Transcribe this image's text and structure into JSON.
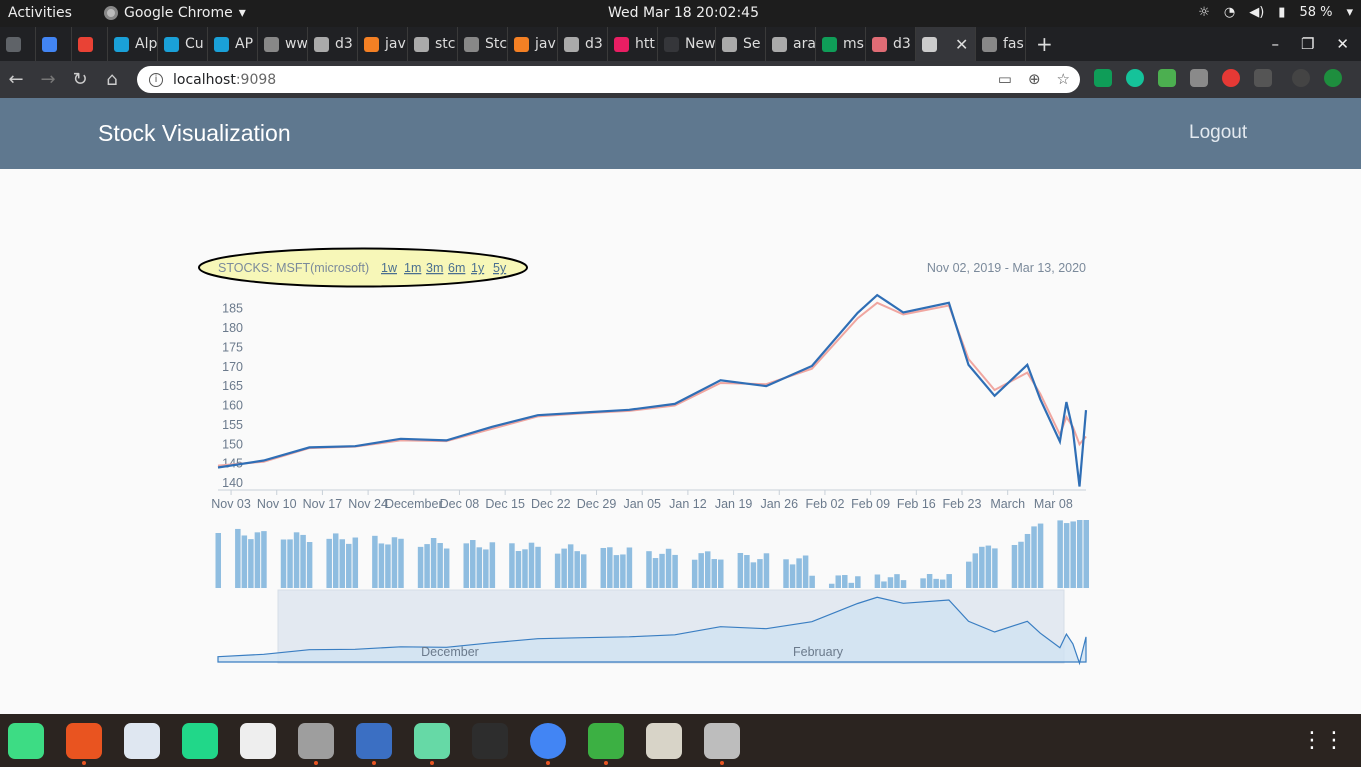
{
  "system": {
    "activities": "Activities",
    "app_name": "Google Chrome",
    "clock": "Wed Mar 18  20:02:45",
    "battery": "58 %"
  },
  "tabs": [
    {
      "label": "",
      "color": "#5f6368"
    },
    {
      "label": "",
      "color": "#4285f4"
    },
    {
      "label": "",
      "color": "#e94235"
    },
    {
      "label": "Alp",
      "color": "#1aa0d8"
    },
    {
      "label": "Cu",
      "color": "#1aa0d8"
    },
    {
      "label": "AP",
      "color": "#1aa0d8"
    },
    {
      "label": "ww",
      "color": "#888888"
    },
    {
      "label": "d3",
      "color": "#aaaaaa"
    },
    {
      "label": "jav",
      "color": "#f48024"
    },
    {
      "label": "stc",
      "color": "#aaaaaa"
    },
    {
      "label": "Stc",
      "color": "#888888"
    },
    {
      "label": "jav",
      "color": "#f48024"
    },
    {
      "label": "d3",
      "color": "#aaaaaa"
    },
    {
      "label": "htt",
      "color": "#e91e63"
    },
    {
      "label": "New T",
      "color": "#35363a"
    },
    {
      "label": "Se",
      "color": "#aaaaaa"
    },
    {
      "label": "ara",
      "color": "#aaaaaa"
    },
    {
      "label": "ms",
      "color": "#0f9d58"
    },
    {
      "label": "d3",
      "color": "#e06c75"
    },
    {
      "label": "",
      "color": "#cccccc",
      "active": true
    },
    {
      "label": "fas",
      "color": "#888888"
    }
  ],
  "browser": {
    "url_host": "localhost",
    "url_port": ":9098"
  },
  "app": {
    "brand": "Stock Visualization",
    "logout": "Logout"
  },
  "chart_controls": {
    "stock_label": "STOCKS: MSFT(microsoft)",
    "ranges": [
      "1w",
      "1m",
      "3m",
      "6m",
      "1y",
      "5y"
    ],
    "date_range": "Nov 02, 2019 - Mar 13, 2020",
    "highlight_color": "#f7f7b8"
  },
  "chart_data": {
    "type": "line",
    "title": "",
    "ylim": [
      140,
      188
    ],
    "y_ticks": [
      140,
      145,
      150,
      155,
      160,
      165,
      170,
      175,
      180,
      185
    ],
    "x_tick_labels": [
      "Nov 03",
      "Nov 10",
      "Nov 17",
      "Nov 24",
      "December",
      "Dec 08",
      "Dec 15",
      "Dec 22",
      "Dec 29",
      "Jan 05",
      "Jan 12",
      "Jan 19",
      "Jan 26",
      "Feb 02",
      "Feb 09",
      "Feb 16",
      "Feb 23",
      "March",
      "Mar 08"
    ],
    "x": [
      "2019-11-01",
      "2019-11-08",
      "2019-11-15",
      "2019-11-22",
      "2019-11-29",
      "2019-12-06",
      "2019-12-13",
      "2019-12-20",
      "2019-12-27",
      "2020-01-03",
      "2020-01-10",
      "2020-01-17",
      "2020-01-24",
      "2020-01-31",
      "2020-02-07",
      "2020-02-10",
      "2020-02-14",
      "2020-02-21",
      "2020-02-24",
      "2020-02-28",
      "2020-03-04",
      "2020-03-06",
      "2020-03-09",
      "2020-03-10",
      "2020-03-11",
      "2020-03-12",
      "2020-03-13"
    ],
    "series": [
      {
        "values": [
          144.0,
          145.8,
          149.2,
          149.5,
          151.4,
          151.0,
          154.5,
          157.5,
          158.2,
          158.9,
          160.4,
          166.5,
          165.0,
          170.2,
          183.9,
          188.5,
          184.0,
          186.5,
          170.5,
          162.5,
          170.5,
          161.6,
          150.7,
          160.9,
          153.6,
          139.1,
          158.8
        ],
        "color": "#2f6eb5"
      },
      {
        "values": [
          144.5,
          145.5,
          149.0,
          149.4,
          151.0,
          150.8,
          154.0,
          157.2,
          158.0,
          158.6,
          160.0,
          165.8,
          165.5,
          169.5,
          182.5,
          186.5,
          183.5,
          185.8,
          172.0,
          164.0,
          168.5,
          163.0,
          152.5,
          157.0,
          154.5,
          150.0,
          152.0
        ],
        "color": "#f0a6a0"
      }
    ],
    "volume_color": "#8fbde0",
    "navigator": {
      "labels": [
        "December",
        "February"
      ],
      "fill": "#cfe2f3",
      "line": "#3a7ec2"
    }
  },
  "dock": [
    {
      "name": "android-studio-icon",
      "color": "#3ddc84"
    },
    {
      "name": "software-center-icon",
      "color": "#e95420"
    },
    {
      "name": "libreoffice-writer-icon",
      "color": "#dfe7f1"
    },
    {
      "name": "pycharm-icon",
      "color": "#21d789"
    },
    {
      "name": "document-viewer-icon",
      "color": "#eeeeee"
    },
    {
      "name": "settings-icon",
      "color": "#9e9e9e"
    },
    {
      "name": "file-manager-icon",
      "color": "#3b6fc3"
    },
    {
      "name": "atom-icon",
      "color": "#66d9a6"
    },
    {
      "name": "terminal-icon",
      "color": "#2d2d2d"
    },
    {
      "name": "chrome-icon",
      "color": "#4285f4"
    },
    {
      "name": "libreoffice-calc-icon",
      "color": "#3cb043"
    },
    {
      "name": "files-icon",
      "color": "#d8d4c8"
    },
    {
      "name": "disks-icon",
      "color": "#bdbdbd"
    }
  ]
}
